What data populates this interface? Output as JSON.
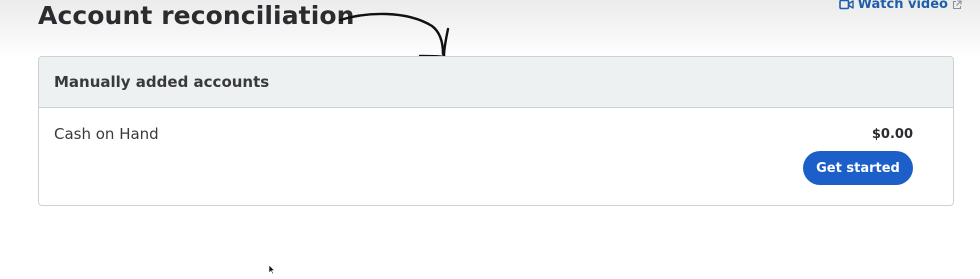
{
  "page": {
    "title": "Account reconciliation"
  },
  "help": {
    "watch_video_label": "Watch video",
    "icon": "video-camera-icon",
    "external_icon": "external-link-icon",
    "color": "#1f5ea8"
  },
  "accounts_section": {
    "header": "Manually added accounts",
    "accounts": [
      {
        "name": "Cash on Hand",
        "balance": "$0.00",
        "action_label": "Get started"
      }
    ]
  },
  "colors": {
    "primary_button": "#1d5fc9",
    "header_background": "#eef1f1",
    "border": "#c9d3d6"
  }
}
